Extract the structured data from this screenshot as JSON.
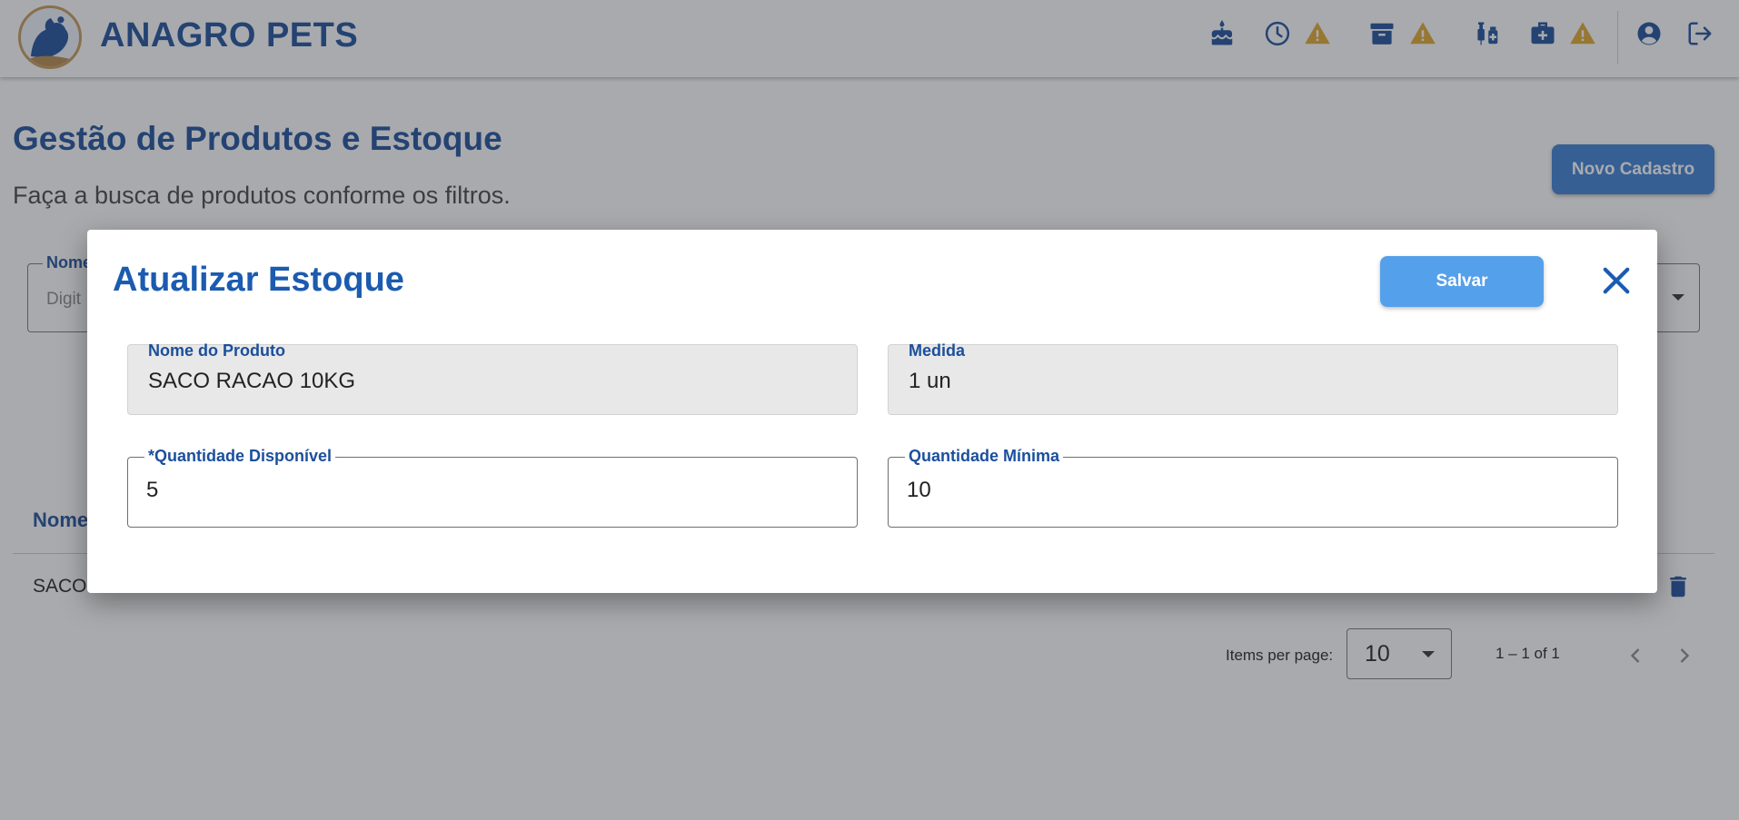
{
  "app": {
    "brand": "ANAGRO PETS"
  },
  "header": {
    "icons": [
      "cake-icon",
      "clock-icon",
      "warning-icon",
      "archive-icon",
      "warning-icon",
      "vaccine-icon",
      "medical-kit-icon",
      "warning-icon",
      "account-icon",
      "logout-icon"
    ],
    "warning_color": "#e0a72a",
    "icon_color": "#1b4f9c"
  },
  "page": {
    "title": "Gestão de Produtos e Estoque",
    "subtitle": "Faça a busca de produtos conforme os filtros.",
    "new_button": "Novo Cadastro",
    "filter_label": "Nome",
    "filter_placeholder": "Digit"
  },
  "table": {
    "header_nome": "Nome",
    "row_nome": "SACO",
    "items_per_page_label": "Items per page:",
    "items_per_page_value": "10",
    "range": "1 – 1 of 1"
  },
  "dialog": {
    "title": "Atualizar Estoque",
    "save_label": "Salvar",
    "fields": {
      "product_name": {
        "label": "Nome do Produto",
        "value": "SACO RACAO 10KG"
      },
      "measure": {
        "label": "Medida",
        "value": "1 un"
      },
      "available_qty": {
        "label": "*Quantidade Disponível",
        "value": "5"
      },
      "min_qty": {
        "label": "Quantidade Mínima",
        "value": "10"
      }
    }
  },
  "colors": {
    "primary": "#1b4f9c",
    "button": "#3a7fd5",
    "save_button": "#55a0ea"
  }
}
